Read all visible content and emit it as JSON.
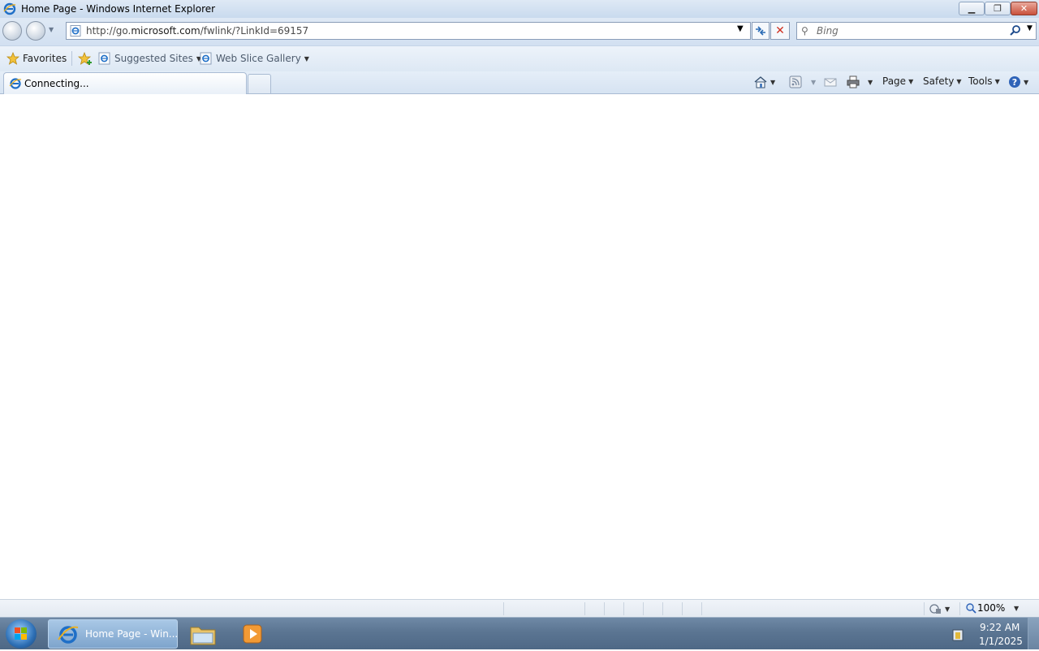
{
  "window": {
    "title": "Home Page - Windows Internet Explorer"
  },
  "address_bar": {
    "url_prefix": "http://go.",
    "url_domain": "microsoft.com",
    "url_path": "/fwlink/?LinkId=69157"
  },
  "search": {
    "placeholder": "Bing"
  },
  "favorites_bar": {
    "favorites_label": "Favorites",
    "suggested_sites_label": "Suggested Sites",
    "web_slice_gallery_label": "Web Slice Gallery"
  },
  "tabs": [
    {
      "label": "Connecting..."
    }
  ],
  "command_bar": {
    "page_label": "Page",
    "safety_label": "Safety",
    "tools_label": "Tools"
  },
  "status_bar": {
    "zoom": "100%"
  },
  "taskbar": {
    "ie_button_label": "Home Page - Win...",
    "time": "9:22 AM",
    "date": "1/1/2025"
  },
  "colors": {
    "title_bar": "#dfe9f5",
    "close_button": "#c9503b",
    "taskbar": "#5b7592",
    "stop_icon": "#d03020",
    "ie_icon": "#1f6fc7"
  },
  "icons": {
    "ie": "ie-logo-icon",
    "home": "home-icon",
    "feeds": "rss-feed-icon",
    "mail": "mail-icon",
    "print": "printer-icon",
    "help": "help-icon",
    "search": "magnifier-icon",
    "favorites": "star-icon"
  }
}
